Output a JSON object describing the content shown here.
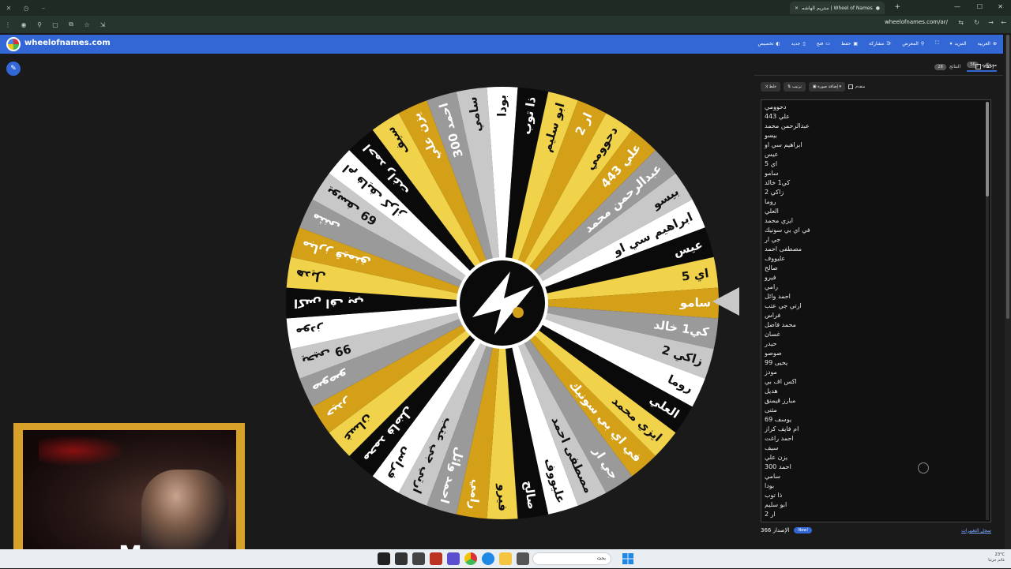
{
  "browser": {
    "tab_title": "Wheel of Names | ستريم الهاشماني",
    "url": "wheelofnames.com/ar/"
  },
  "app": {
    "site_name": "wheelofnames.com",
    "menu": [
      "العربية",
      "المزيد",
      "",
      "المعرض",
      "مشاركة",
      "حفظ",
      "فتح",
      "جديد",
      "تخصيص"
    ]
  },
  "panel": {
    "tab_entries": "مدخلات",
    "entries_count": "56",
    "tab_results": "النتائج",
    "results_count": "28",
    "hide_label": "إخفاء",
    "shuffle_label": "خلط",
    "sort_label": "ترتيب",
    "add_image_label": "إضافة صورة",
    "advanced_label": "متقدم",
    "version": "366 الإصدار",
    "new_badge": "New!",
    "changelog": "سجل التغييرات",
    "entries": [
      "دحوومي",
      "علي 443",
      "عبدالرحمن محمد",
      "بيسو",
      "ابراهيم سي او",
      "عيس",
      "اي 5",
      "سامو",
      "كي1 خالد",
      "زاكي 2",
      "روما",
      "العلي",
      "ايزي محمد",
      "في اي بي سونيك",
      "جي ار",
      "مصطفى احمد",
      "عليووف",
      "صالح",
      "فيرو",
      "رامي",
      "احمد وائل",
      "ارتي جي عتب",
      "فراس",
      "محمد فاضل",
      "غسان",
      "حيدر",
      "صوصو",
      "يحيى 99",
      "مودز",
      "اكس اف بي",
      "هديل",
      "مبارز قيمنق",
      "مثنى",
      "يوسف 69",
      "ام فايف كراز",
      "احمد راغت",
      "سيف",
      "يزن علي",
      "احمد 300",
      "سامي",
      "بودا",
      "ذا توب",
      "ابو سليم",
      "ار 2"
    ]
  },
  "wheel": {
    "selected": "سامو",
    "colors": [
      "#f0d34a",
      "#d4a017",
      "#9a9a9a",
      "#c8c8c8",
      "#ffffff",
      "#0a0a0a"
    ]
  },
  "taskbar": {
    "search_placeholder": "بحث",
    "temperature": "23°C",
    "weather": "غائم جزئيا"
  }
}
